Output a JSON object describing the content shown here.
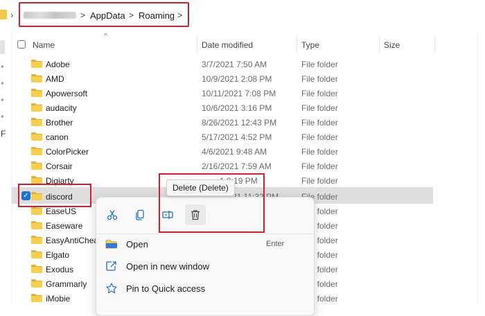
{
  "address": {
    "blurred_segment": "",
    "crumbs": [
      "AppData",
      "Roaming"
    ]
  },
  "columns": {
    "name": "Name",
    "date": "Date modified",
    "type": "Type",
    "size": "Size"
  },
  "left_nav": {
    "letter": "F"
  },
  "files": [
    {
      "name": "Adobe",
      "date": "3/7/2021 7:50 AM",
      "type": "File folder"
    },
    {
      "name": "AMD",
      "date": "10/9/2021 2:08 PM",
      "type": "File folder"
    },
    {
      "name": "Apowersoft",
      "date": "10/11/2021 7:08 PM",
      "type": "File folder"
    },
    {
      "name": "audacity",
      "date": "10/6/2021 3:16 PM",
      "type": "File folder"
    },
    {
      "name": "Brother",
      "date": "8/26/2021 12:43 PM",
      "type": "File folder"
    },
    {
      "name": "canon",
      "date": "5/17/2021 4:52 PM",
      "type": "File folder"
    },
    {
      "name": "ColorPicker",
      "date": "4/6/2021 9:48 AM",
      "type": "File folder"
    },
    {
      "name": "Corsair",
      "date": "2/16/2021 7:59 AM",
      "type": "File folder"
    },
    {
      "name": "Digiarty",
      "date": "1 9:19 PM",
      "type": "File folder"
    },
    {
      "name": "discord",
      "date": "21 11:32 PM",
      "type": "File folder",
      "selected": true
    },
    {
      "name": "EaseUS",
      "date": "",
      "type": "File folder"
    },
    {
      "name": "Easeware",
      "date": "",
      "type": "File folder"
    },
    {
      "name": "EasyAntiChea",
      "date": "",
      "type": "File folder"
    },
    {
      "name": "Elgato",
      "date": "",
      "type": "File folder"
    },
    {
      "name": "Exodus",
      "date": "",
      "type": "File folder"
    },
    {
      "name": "Grammarly",
      "date": "",
      "type": "File folder"
    },
    {
      "name": "iMobie",
      "date": "",
      "type": "File folder"
    }
  ],
  "tooltip": "Delete (Delete)",
  "context_menu": {
    "toolbar_icons": [
      "cut-icon",
      "copy-icon",
      "rename-icon",
      "delete-icon"
    ],
    "items": [
      {
        "label": "Open",
        "shortcut": "Enter",
        "icon": "folder-open-icon"
      },
      {
        "label": "Open in new window",
        "shortcut": "",
        "icon": "open-new-window-icon"
      },
      {
        "label": "Pin to Quick access",
        "shortcut": "",
        "icon": "star-icon"
      }
    ]
  },
  "colors": {
    "highlight_box": "#d31f2a",
    "folder": "#f8cf4c",
    "checkbox": "#1a73d0",
    "selection": "#dedede"
  }
}
